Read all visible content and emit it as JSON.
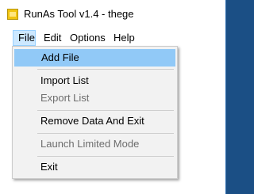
{
  "window": {
    "title": "RunAs Tool v1.4 - thege",
    "icon": "app-icon"
  },
  "menubar": {
    "items": [
      {
        "label": "File",
        "active": true
      },
      {
        "label": "Edit",
        "active": false
      },
      {
        "label": "Options",
        "active": false
      },
      {
        "label": "Help",
        "active": false
      }
    ]
  },
  "file_menu": {
    "items": [
      {
        "label": "Add File",
        "enabled": true,
        "highlighted": true
      },
      {
        "label": "Import List",
        "enabled": true,
        "highlighted": false
      },
      {
        "label": "Export List",
        "enabled": false,
        "highlighted": false
      },
      {
        "label": "Remove Data And Exit",
        "enabled": true,
        "highlighted": false
      },
      {
        "label": "Launch Limited Mode",
        "enabled": false,
        "highlighted": false
      },
      {
        "label": "Exit",
        "enabled": true,
        "highlighted": false
      }
    ]
  },
  "colors": {
    "menu_highlight": "#91c9f7",
    "menubar_active": "#cce8ff",
    "menu_background": "#f2f2f2",
    "disabled_text": "#6d6d6d"
  }
}
